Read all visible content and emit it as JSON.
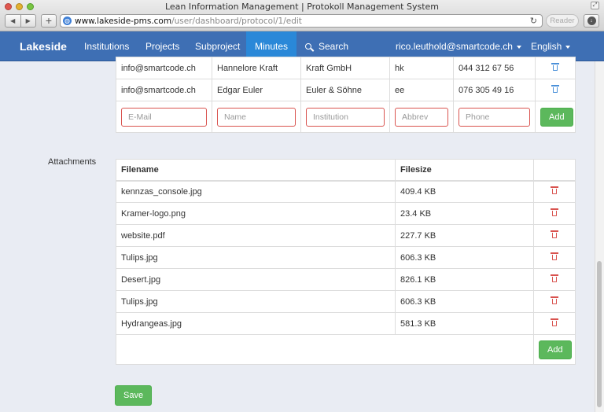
{
  "browser": {
    "window_title": "Lean Information Management | Protokoll Management System",
    "url_host": "www.lakeside-pms.com",
    "url_path": "/user/dashboard/protocol/1/edit",
    "reader_label": "Reader"
  },
  "nav": {
    "brand": "Lakeside",
    "links": [
      "Institutions",
      "Projects",
      "Subproject",
      "Minutes"
    ],
    "active": "Minutes",
    "search_label": "Search",
    "user": "rico.leuthold@smartcode.ch",
    "language": "English"
  },
  "contacts": {
    "rows": [
      {
        "email": "info@smartcode.ch",
        "name": "Hannelore Kraft",
        "institution": "Kraft GmbH",
        "abbrev": "hk",
        "phone": "044 312 67 56"
      },
      {
        "email": "info@smartcode.ch",
        "name": "Edgar Euler",
        "institution": "Euler & Söhne",
        "abbrev": "ee",
        "phone": "076 305 49 16"
      }
    ],
    "placeholders": {
      "email": "E-Mail",
      "name": "Name",
      "institution": "Institution",
      "abbrev": "Abbrev",
      "phone": "Phone"
    },
    "add_label": "Add"
  },
  "attachments": {
    "label": "Attachments",
    "headers": {
      "filename": "Filename",
      "filesize": "Filesize"
    },
    "rows": [
      {
        "filename": "kennzas_console.jpg",
        "filesize": "409.4 KB"
      },
      {
        "filename": "Kramer-logo.png",
        "filesize": "23.4 KB"
      },
      {
        "filename": "website.pdf",
        "filesize": "227.7 KB"
      },
      {
        "filename": "Tulips.jpg",
        "filesize": "606.3 KB"
      },
      {
        "filename": "Desert.jpg",
        "filesize": "826.1 KB"
      },
      {
        "filename": "Tulips.jpg",
        "filesize": "606.3 KB"
      },
      {
        "filename": "Hydrangeas.jpg",
        "filesize": "581.3 KB"
      }
    ],
    "add_label": "Add"
  },
  "save_label": "Save",
  "colors": {
    "navbar": "#3e6fb4",
    "nav_active": "#2a88d8",
    "success": "#5cb85c",
    "danger": "#d9534f"
  }
}
